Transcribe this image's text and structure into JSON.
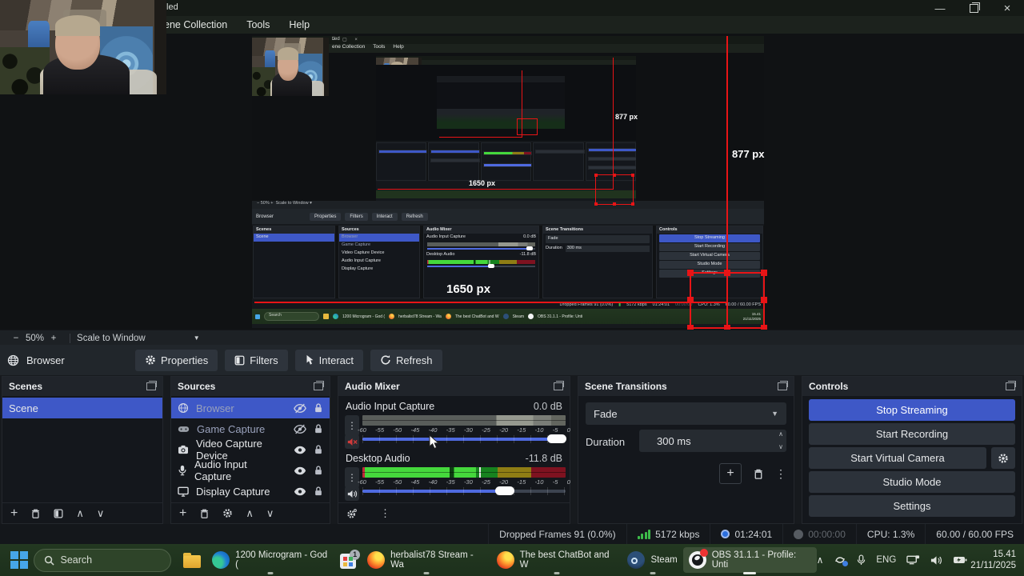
{
  "window": {
    "title": "tled"
  },
  "menubar": {
    "items": [
      "ene Collection",
      "Tools",
      "Help"
    ]
  },
  "preview": {
    "width_label": "1650 px",
    "height_label": "877 px"
  },
  "zoombar": {
    "minus": "−",
    "level": "50%",
    "plus": "+",
    "scale_mode": "Scale to Window"
  },
  "source_toolbar": {
    "source": "Browser",
    "properties": "Properties",
    "filters": "Filters",
    "interact": "Interact",
    "refresh": "Refresh"
  },
  "scenes": {
    "title": "Scenes",
    "items": [
      {
        "label": "Scene"
      }
    ]
  },
  "sources": {
    "title": "Sources",
    "items": [
      {
        "label": "Browser",
        "icon": "globe-icon",
        "visible": false,
        "locked": true,
        "selected": true
      },
      {
        "label": "Game Capture",
        "icon": "gamepad-icon",
        "visible": false,
        "locked": true,
        "selected": false
      },
      {
        "label": "Video Capture Device",
        "icon": "camera-icon",
        "visible": true,
        "locked": true,
        "selected": false
      },
      {
        "label": "Audio Input Capture",
        "icon": "microphone-icon",
        "visible": true,
        "locked": true,
        "selected": false
      },
      {
        "label": "Display Capture",
        "icon": "monitor-icon",
        "visible": true,
        "locked": true,
        "selected": false
      }
    ]
  },
  "audio_mixer": {
    "title": "Audio Mixer",
    "ticks": [
      "-60",
      "-55",
      "-50",
      "-45",
      "-40",
      "-35",
      "-30",
      "-25",
      "-20",
      "-15",
      "-10",
      "-5",
      "0"
    ],
    "channels": [
      {
        "name": "Audio Input Capture",
        "db": "0.0 dB",
        "muted": true
      },
      {
        "name": "Desktop Audio",
        "db": "-11.8 dB",
        "muted": false
      }
    ]
  },
  "transitions": {
    "title": "Scene Transitions",
    "transition": "Fade",
    "duration_label": "Duration",
    "duration_value": "300 ms"
  },
  "controls": {
    "title": "Controls",
    "buttons": [
      "Stop Streaming",
      "Start Recording",
      "Start Virtual Camera",
      "Studio Mode",
      "Settings"
    ]
  },
  "statusbar": {
    "dropped": "Dropped Frames 91 (0.0%)",
    "bitrate": "5172 kbps",
    "stream_time": "01:24:01",
    "rec_time": "00:00:00",
    "cpu": "CPU: 1.3%",
    "fps": "60.00 / 60.00 FPS"
  },
  "taskbar": {
    "search": "Search",
    "apps": [
      {
        "title": "1200 Microgram - God ("
      },
      {
        "title": "herbalist78 Stream - Wa"
      },
      {
        "title": "The best ChatBot and W"
      },
      {
        "title": "Steam"
      },
      {
        "title": "OBS 31.1.1 - Profile: Unti"
      }
    ],
    "store_badge": "1",
    "tray": {
      "lang": "ENG",
      "time": "15.41",
      "date": "21/11/2025"
    }
  }
}
